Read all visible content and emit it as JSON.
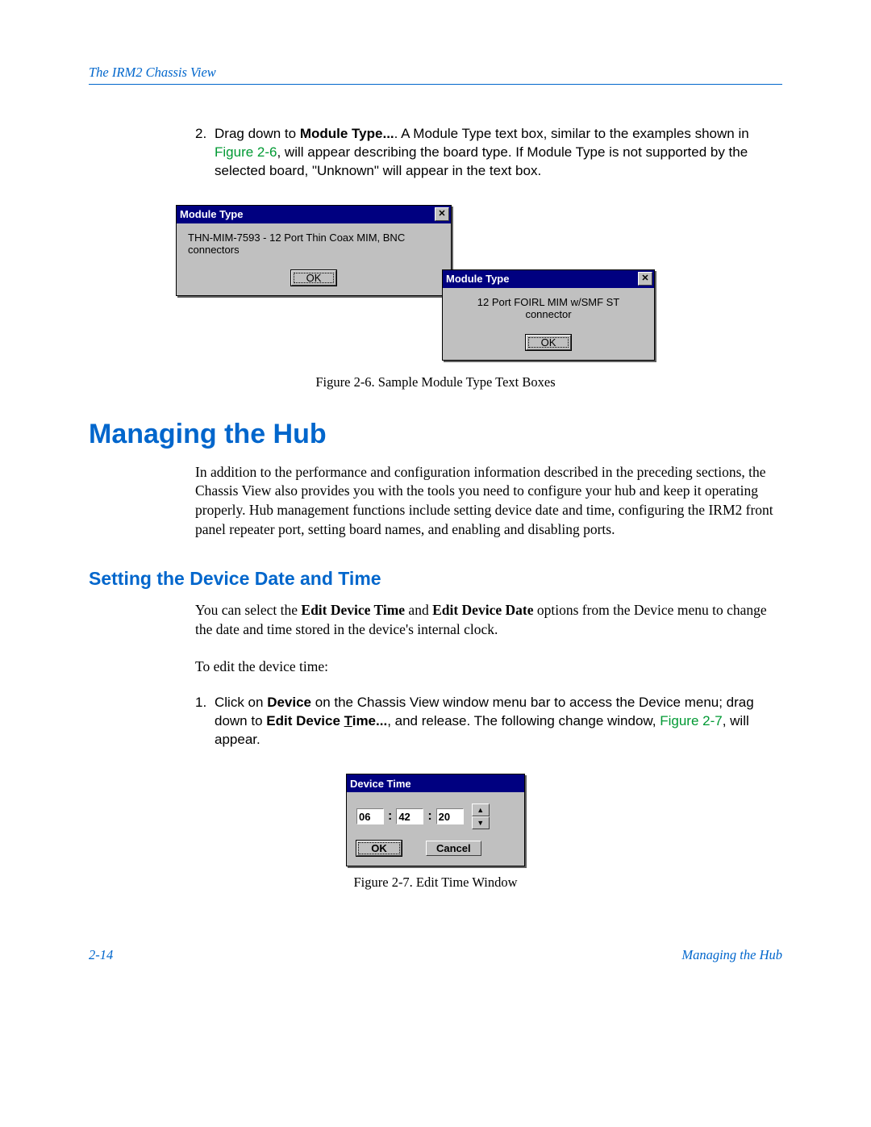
{
  "header": {
    "title": "The IRM2 Chassis View"
  },
  "step2": {
    "number": "2.",
    "prefix": "Drag down to ",
    "bold1": "Module Type...",
    "mid1": ". A Module Type text box, similar to the examples shown in ",
    "linkref": "Figure 2-6",
    "mid2": ", will appear describing the board type. If Module Type is not supported by the selected board, \"Unknown\" will appear in the text box."
  },
  "dialog1": {
    "title": "Module Type",
    "content": "THN-MIM-7593 - 12 Port Thin Coax MIM, BNC connectors",
    "ok": "OK"
  },
  "dialog2": {
    "title": "Module Type",
    "content": "12 Port FOIRL MIM w/SMF ST connector",
    "ok": "OK"
  },
  "figcap1": "Figure 2-6. Sample Module Type Text Boxes",
  "h1": "Managing the Hub",
  "para1": "In addition to the performance and configuration information described in the preceding sections, the Chassis View also provides you with the tools you need to configure your hub and keep it operating properly. Hub management functions include setting device date and time, configuring the IRM2 front panel repeater port, setting board names, and enabling and disabling ports.",
  "h2": "Setting the Device Date and Time",
  "para2_a": "You can select the ",
  "para2_b1": "Edit Device Time",
  "para2_c": " and ",
  "para2_b2": "Edit Device Date",
  "para2_d": " options from the Device menu to change the date and time stored in the device's internal clock.",
  "para3": "To edit the device time:",
  "step1": {
    "number": "1.",
    "t1": "Click on ",
    "b1": "Device",
    "t2": " on the Chassis View window menu bar to access the Device menu; drag down to ",
    "b2a": "Edit Device ",
    "b2u": "T",
    "b2b": "ime...",
    "t3": ", and release. The following change window, ",
    "link": "Figure 2-7",
    "t4": ", will appear."
  },
  "devicetime": {
    "title": "Device Time",
    "hh": "06",
    "mm": "42",
    "ss": "20",
    "ok": "OK",
    "cancel": "Cancel"
  },
  "figcap2": "Figure 2-7. Edit Time Window",
  "footer": {
    "pagenum": "2-14",
    "section": "Managing the Hub"
  }
}
